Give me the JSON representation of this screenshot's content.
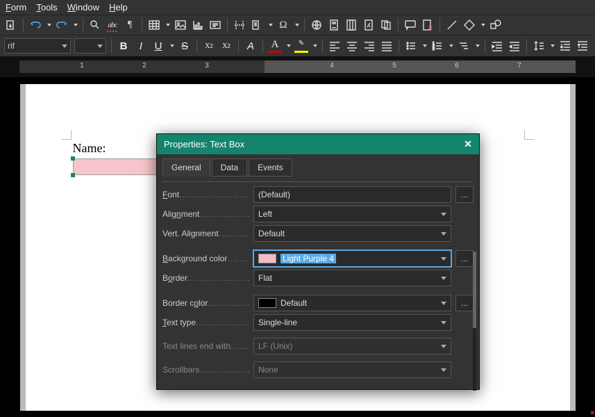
{
  "menubar": {
    "form": "Form",
    "tools": "Tools",
    "window": "Window",
    "help": "Help"
  },
  "toolbar2": {
    "font_name": "rif",
    "font_size": ""
  },
  "document": {
    "label": "Name:"
  },
  "dialog": {
    "title": "Properties: Text Box",
    "tabs": {
      "general": "General",
      "data": "Data",
      "events": "Events"
    },
    "rows": {
      "font_label": "Font",
      "font_value": "(Default)",
      "align_label": "Alignment",
      "align_value": "Left",
      "valign_label": "Vert. Alignment",
      "valign_value": "Default",
      "bg_label": "Background color",
      "bg_value": "Light Purple 4",
      "border_label": "Border",
      "border_value": "Flat",
      "bordercolor_label": "Border color",
      "bordercolor_value": "Default",
      "texttype_label": "Text type",
      "texttype_value": "Single-line",
      "eol_label": "Text lines end with",
      "eol_value": "LF (Unix)",
      "scroll_label": "Scrollbars",
      "scroll_value": "None"
    },
    "more": "..."
  }
}
